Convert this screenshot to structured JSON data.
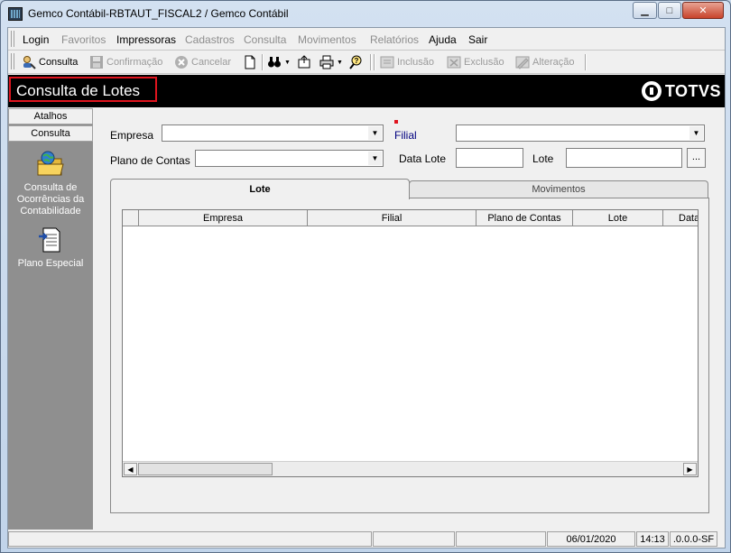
{
  "window": {
    "title": "Gemco Contábil-RBTAUT_FISCAL2 / Gemco Contábil",
    "minimize_glyph": "▁",
    "maximize_glyph": "□",
    "close_glyph": "✕"
  },
  "menu": [
    {
      "label": "Login",
      "enabled": true
    },
    {
      "label": "Favoritos",
      "enabled": false
    },
    {
      "label": "Impressoras",
      "enabled": true
    },
    {
      "label": "Cadastros",
      "enabled": false
    },
    {
      "label": "Consulta",
      "enabled": false
    },
    {
      "label": "Movimentos",
      "enabled": false
    },
    {
      "label": "Relatórios",
      "enabled": false
    },
    {
      "label": "Ajuda",
      "enabled": true
    },
    {
      "label": "Sair",
      "enabled": true
    }
  ],
  "toolbar": {
    "consulta": "Consulta",
    "confirmacao": "Confirmação",
    "cancelar": "Cancelar",
    "inclusao": "Inclusão",
    "exclusao": "Exclusão",
    "alteracao": "Alteração"
  },
  "header": {
    "page_title": "Consulta de Lotes",
    "brand": "TOTVS"
  },
  "sidebar": {
    "tab_atalhos": "Atalhos",
    "tab_consulta": "Consulta",
    "entries": [
      {
        "label": "Consulta de Ocorrências da Contabilidade",
        "icon": "folder-globe-icon"
      },
      {
        "label": "Plano Especial",
        "icon": "document-arrow-icon"
      }
    ]
  },
  "form": {
    "empresa_label": "Empresa",
    "empresa_value": "",
    "filial_label": "Filial",
    "filial_value": "",
    "plano_label": "Plano de Contas",
    "plano_value": "",
    "data_lote_label": "Data Lote",
    "data_lote_value": "",
    "lote_label": "Lote",
    "lote_value": "",
    "lookup_glyph": "..."
  },
  "tabs": [
    {
      "label": "Lote",
      "active": true
    },
    {
      "label": "Movimentos",
      "active": false
    }
  ],
  "grid": {
    "columns": [
      "Empresa",
      "Filial",
      "Plano de Contas",
      "Lote",
      "Data"
    ],
    "rows": []
  },
  "status": {
    "date": "06/01/2020",
    "time": "14:13",
    "version": ".0.0.0-SF"
  },
  "colors": {
    "header_band": "#000000",
    "title_highlight": "#e0141e",
    "sidebar": "#8f8f8f",
    "filial_label": "#00007f"
  }
}
